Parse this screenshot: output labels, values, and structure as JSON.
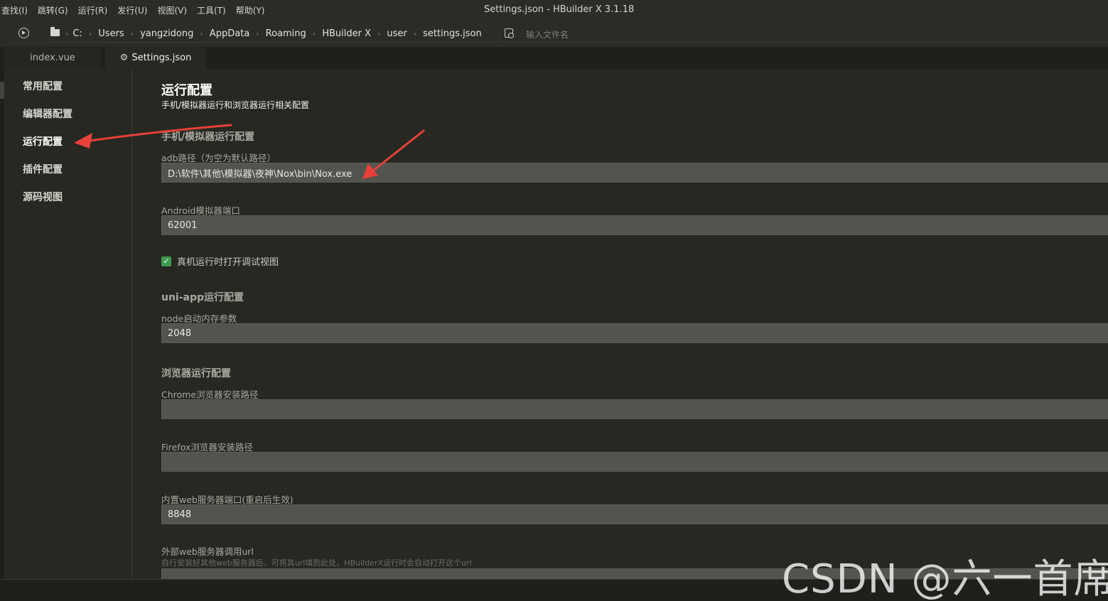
{
  "menu": [
    "查找(I)",
    "跳转(G)",
    "运行(R)",
    "发行(U)",
    "视图(V)",
    "工具(T)",
    "帮助(Y)"
  ],
  "window_title": "Settings.json - HBuilder X 3.1.18",
  "breadcrumb": [
    "C:",
    "Users",
    "yangzidong",
    "AppData",
    "Roaming",
    "HBuilder X",
    "user",
    "settings.json"
  ],
  "file_search": {
    "placeholder": "输入文件名"
  },
  "tabs": [
    {
      "label": "index.vue"
    },
    {
      "label": "Settings.json",
      "icon": "gear-icon"
    }
  ],
  "sidebar": {
    "items": [
      "常用配置",
      "编辑器配置",
      "运行配置",
      "插件配置",
      "源码视图"
    ],
    "active": "运行配置"
  },
  "content": {
    "title": "运行配置",
    "subtitle": "手机/模拟器运行和浏览器运行相关配置",
    "sections": {
      "mobile": "手机/模拟器运行配置",
      "uniapp": "uni-app运行配置",
      "browser": "浏览器运行配置"
    },
    "fields": {
      "adb_label": "adb路径（为空为默认路径）",
      "adb_value": "D:\\软件\\其他\\模拟器\\夜神\\Nox\\bin\\Nox.exe",
      "android_port_label": "Android模拟器端口",
      "android_port_value": "62001",
      "debug_checkbox_label": "真机运行时打开调试视图",
      "debug_checkbox_checked": true,
      "node_mem_label": "node启动内存参数",
      "node_mem_value": "2048",
      "chrome_label": "Chrome浏览器安装路径",
      "chrome_value": "",
      "firefox_label": "Firefox浏览器安装路径",
      "firefox_value": "",
      "web_port_label": "内置web服务器端口(重启后生效)",
      "web_port_value": "8848",
      "ext_url_label": "外部web服务器调用url",
      "ext_url_hint": "自行安装好其他web服务器后，可将其url填到此处。HBuilderX运行时会自动打开这个url",
      "ext_url_value": ""
    }
  },
  "watermark": "CSDN @六一首席",
  "colors": {
    "annotation_arrow": "#e8403a",
    "checkbox": "#3e9a4e",
    "input_bg": "#54544f"
  }
}
